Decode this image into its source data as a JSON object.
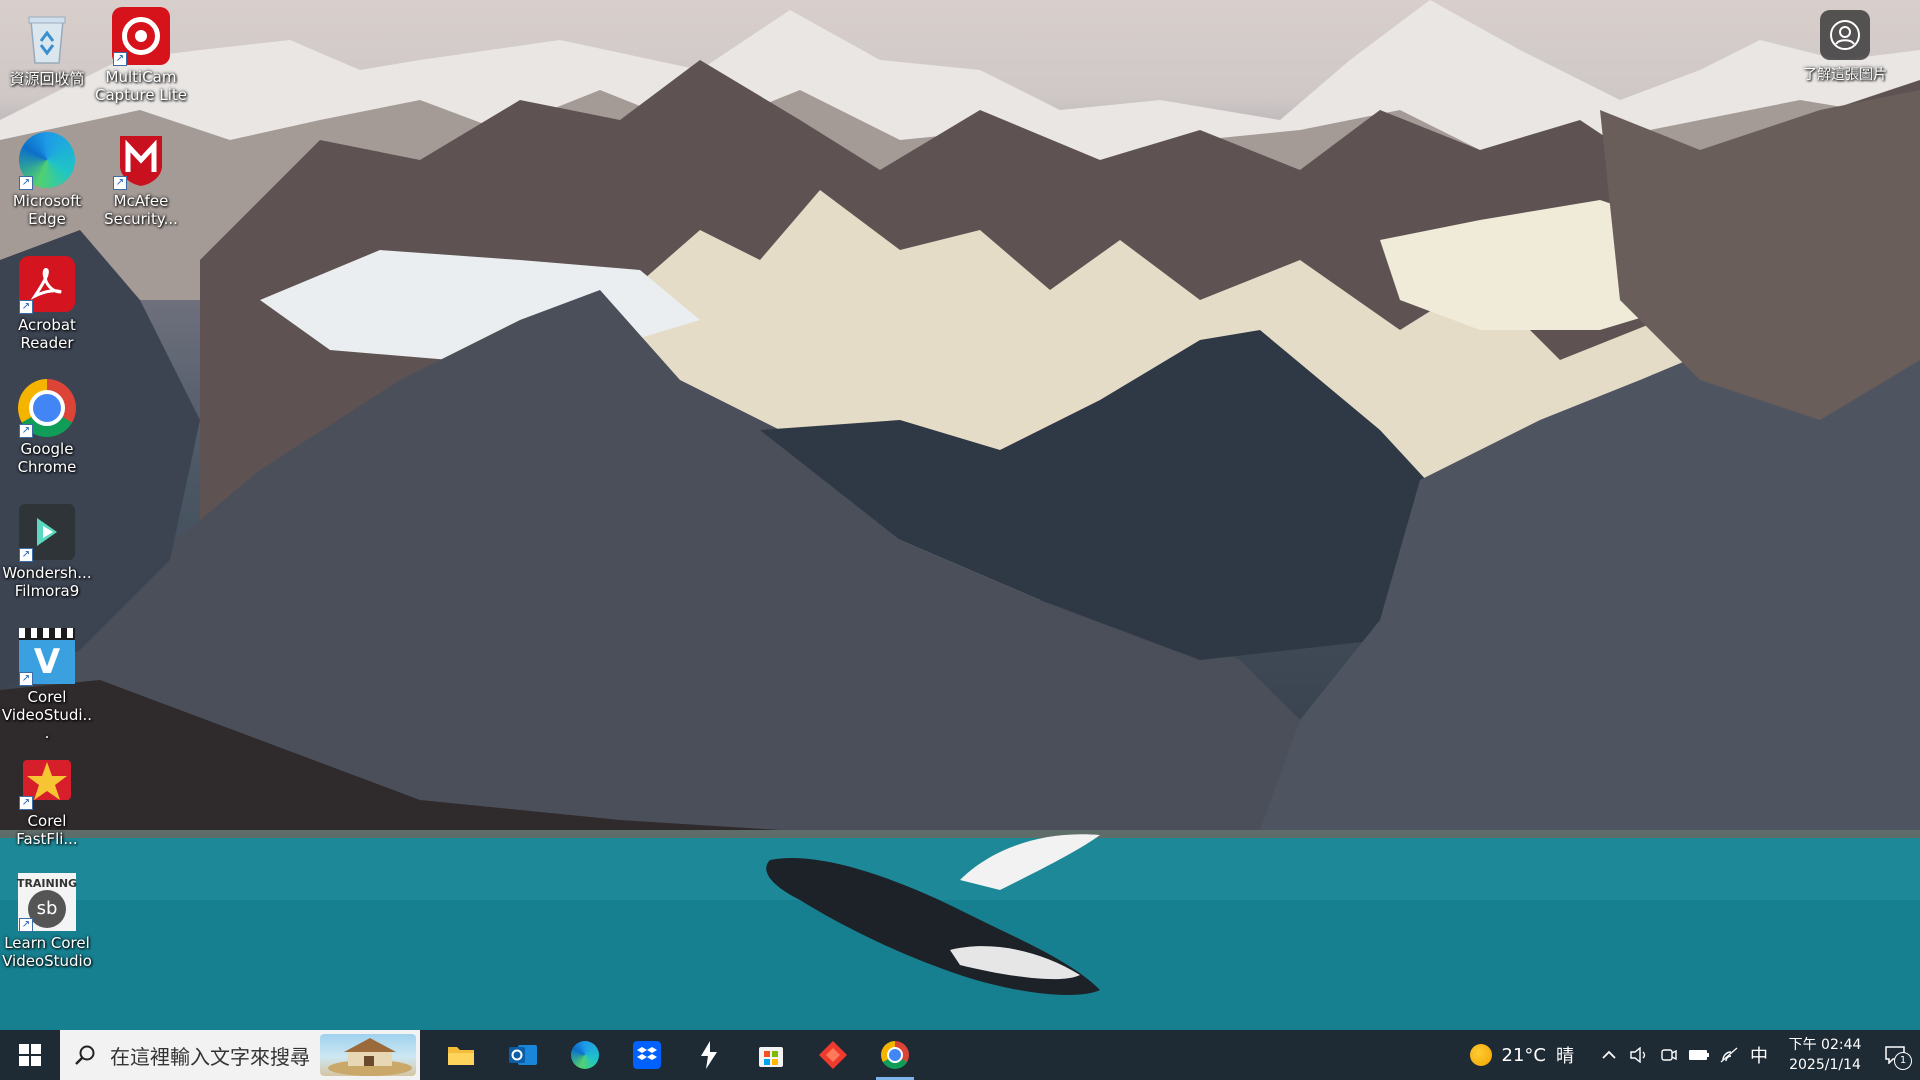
{
  "desktop": {
    "icons": [
      {
        "label": "資源回收筒",
        "icon": "recycle-bin-icon"
      },
      {
        "label": "MultiCam Capture Lite",
        "icon": "multicam-icon"
      },
      {
        "label": "Microsoft Edge",
        "icon": "edge-icon"
      },
      {
        "label": "McAfee Security...",
        "icon": "mcafee-icon"
      },
      {
        "label": "Acrobat Reader",
        "icon": "acrobat-icon"
      },
      {
        "label": "Google Chrome",
        "icon": "chrome-icon"
      },
      {
        "label": "Wondersh... Filmora9",
        "icon": "filmora-icon"
      },
      {
        "label": "Corel VideoStudi...",
        "icon": "corel-videostudio-icon"
      },
      {
        "label": "Corel FastFli...",
        "icon": "corel-fastflick-icon"
      },
      {
        "label": "Learn Corel VideoStudio",
        "icon": "learn-corel-icon"
      }
    ],
    "spotlight_label": "了解這張圖片"
  },
  "taskbar": {
    "search_placeholder": "在這裡輸入文字來搜尋",
    "apps": [
      {
        "name": "File Explorer",
        "icon": "folder-icon"
      },
      {
        "name": "Outlook",
        "icon": "outlook-icon"
      },
      {
        "name": "Microsoft Edge",
        "icon": "edge-icon"
      },
      {
        "name": "Dropbox",
        "icon": "dropbox-icon"
      },
      {
        "name": "Power Automate",
        "icon": "lightning-icon"
      },
      {
        "name": "Microsoft Store",
        "icon": "store-icon"
      },
      {
        "name": "AnyDesk",
        "icon": "diamond-icon"
      },
      {
        "name": "Google Chrome",
        "icon": "chrome-icon"
      }
    ],
    "weather": {
      "temp": "21°C",
      "condition": "晴"
    },
    "ime": "中",
    "clock": {
      "time": "下午 02:44",
      "date": "2025/1/14"
    },
    "notification_count": "1"
  }
}
